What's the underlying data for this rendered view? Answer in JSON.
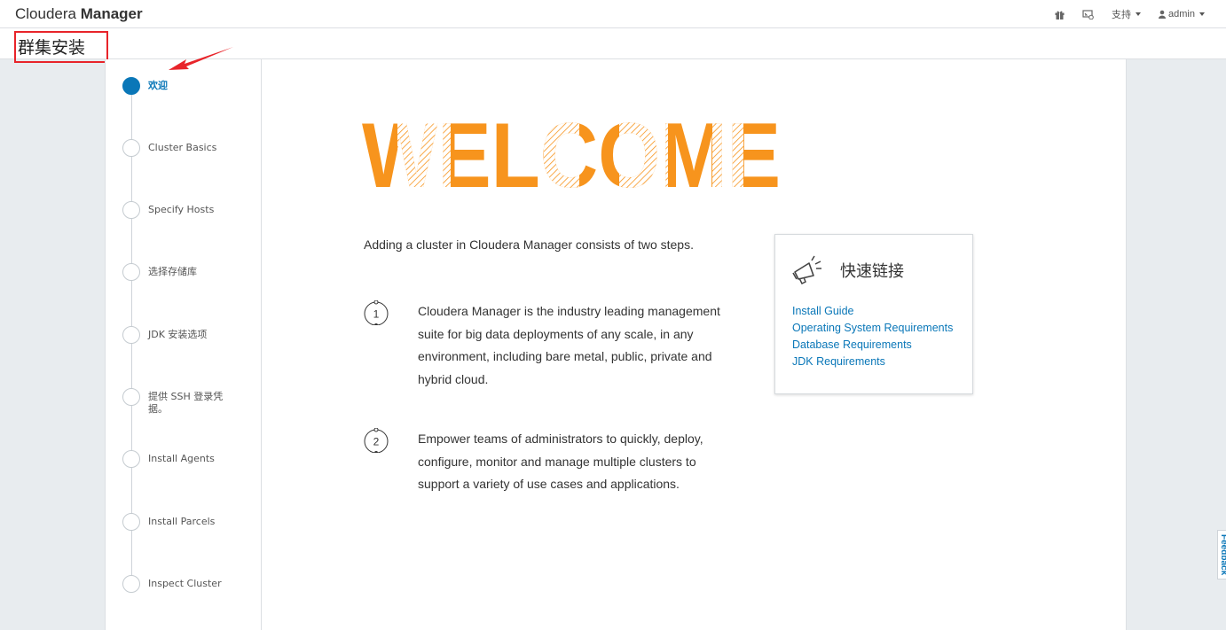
{
  "navbar": {
    "brand_light": "Cloudera ",
    "brand_bold": "Manager",
    "support_label": "支持",
    "admin_label": "admin"
  },
  "page": {
    "title": "群集安装"
  },
  "steps": [
    {
      "label": "欢迎",
      "active": true
    },
    {
      "label": "Cluster Basics",
      "active": false
    },
    {
      "label": "Specify Hosts",
      "active": false
    },
    {
      "label": "选择存储库",
      "active": false
    },
    {
      "label": "JDK 安装选项",
      "active": false
    },
    {
      "label": "提供 SSH 登录凭据。",
      "active": false
    },
    {
      "label": "Install Agents",
      "active": false
    },
    {
      "label": "Install Parcels",
      "active": false
    },
    {
      "label": "Inspect Cluster",
      "active": false
    }
  ],
  "main": {
    "welcome_word": "WELCOME",
    "intro": "Adding a cluster in Cloudera Manager consists of two steps.",
    "items": [
      {
        "num": "1",
        "text": "Cloudera Manager is the industry leading management suite for big data deployments of any scale, in any environment, including bare metal, public, private and hybrid cloud."
      },
      {
        "num": "2",
        "text": "Empower teams of administrators to quickly, deploy, configure, monitor and manage multiple clusters to support a variety of use cases and applications."
      }
    ]
  },
  "quick_links": {
    "title": "快速链接",
    "links": [
      "Install Guide",
      "Operating System Requirements",
      "Database Requirements",
      "JDK Requirements"
    ]
  },
  "feedback": {
    "label": "Feedback"
  },
  "colors": {
    "accent": "#0a77b8",
    "welcome_orange": "#f7941d",
    "annotation_red": "#e8242a"
  },
  "icons": [
    "gift-icon",
    "running-commands-icon",
    "caret-down-icon",
    "user-icon",
    "megaphone-icon"
  ]
}
